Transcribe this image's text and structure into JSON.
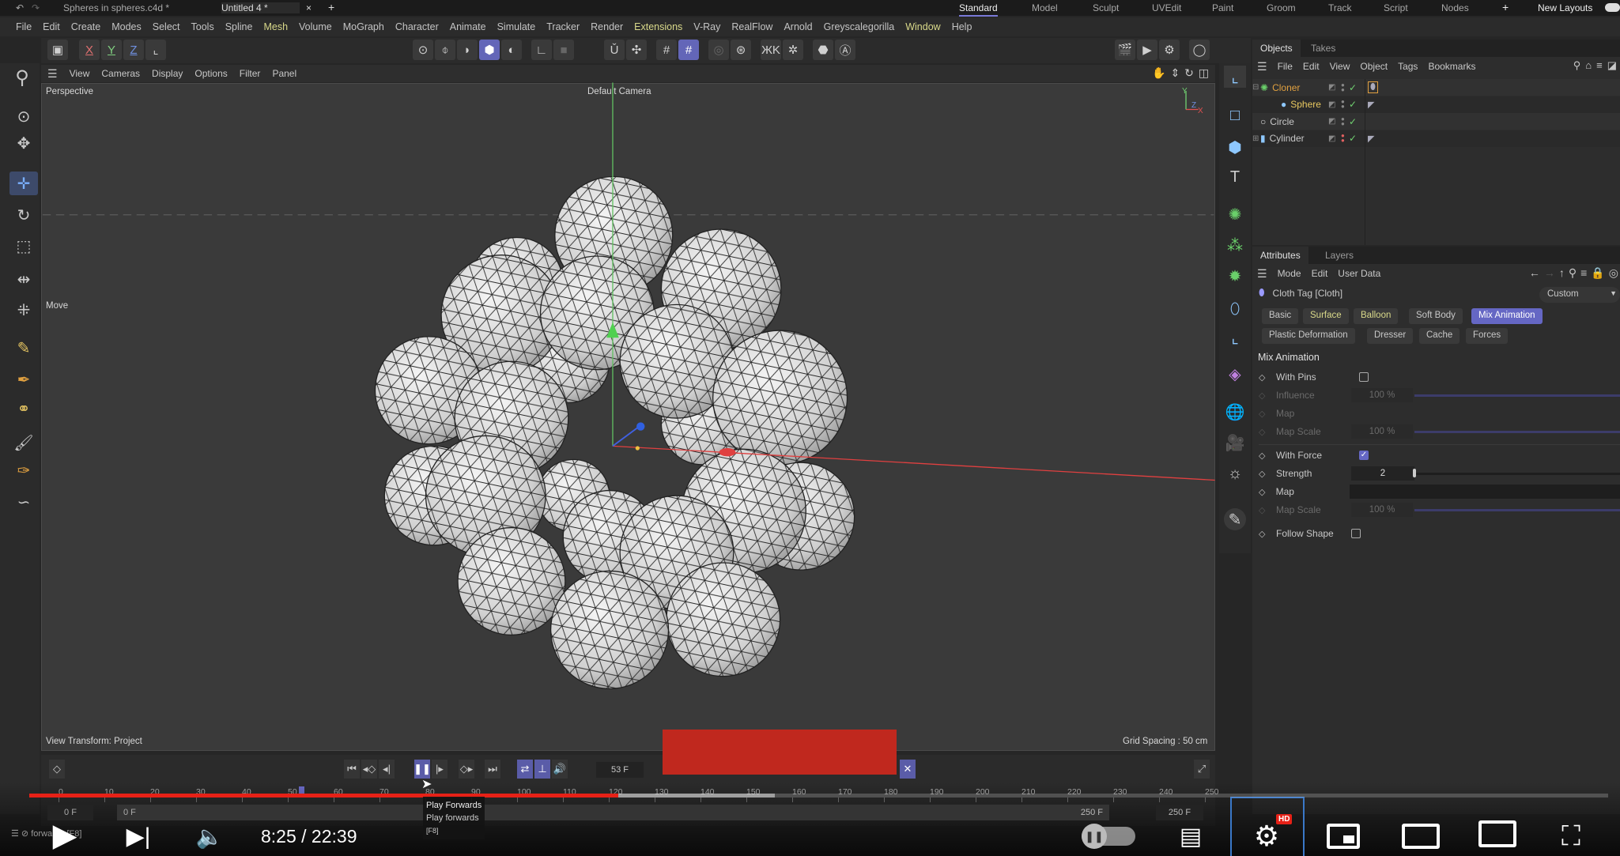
{
  "title_tabs": {
    "undo_icon": "undo-icon",
    "redo_icon": "redo-icon",
    "tabs": [
      {
        "label": "Spheres in spheres.c4d *"
      },
      {
        "label": "Untitled 4 *"
      }
    ],
    "close": "×",
    "add": "+"
  },
  "layouts": {
    "items": [
      "Standard",
      "Model",
      "Sculpt",
      "UVEdit",
      "Paint",
      "Groom",
      "Track",
      "Script",
      "Nodes"
    ],
    "active": "Standard",
    "add": "+",
    "new_layouts": "New Layouts"
  },
  "menu": [
    "File",
    "Edit",
    "Create",
    "Modes",
    "Select",
    "Tools",
    "Spline",
    "Mesh",
    "Volume",
    "MoGraph",
    "Character",
    "Animate",
    "Simulate",
    "Tracker",
    "Render",
    "Extensions",
    "V-Ray",
    "RealFlow",
    "Arnold",
    "Greyscalegorilla",
    "Window",
    "Help"
  ],
  "menu_highlighted": [
    "Mesh",
    "Extensions",
    "Window"
  ],
  "toolbar": {
    "x": "X",
    "y": "Y",
    "z": "Z"
  },
  "viewport": {
    "menu": [
      "View",
      "Cameras",
      "Display",
      "Options",
      "Filter",
      "Panel"
    ],
    "projection": "Perspective",
    "camera": "Default Camera",
    "tool": "Move",
    "view_transform": "View Transform: Project",
    "grid_spacing": "Grid Spacing : 50 cm",
    "axis_y": "Y",
    "axis_z": "Z",
    "axis_x": "X"
  },
  "objects_panel": {
    "tabs": [
      "Objects",
      "Takes"
    ],
    "menu": [
      "File",
      "Edit",
      "View",
      "Object",
      "Tags",
      "Bookmarks"
    ],
    "rows": [
      {
        "name": "Cloner",
        "color": "#e0a040",
        "expand": "⊟"
      },
      {
        "name": "Sphere",
        "color": "#e8c860",
        "expand": ""
      },
      {
        "name": "Circle",
        "color": "#c8c8c8",
        "expand": ""
      },
      {
        "name": "Cylinder",
        "color": "#c8c8c8",
        "expand": "⊞"
      }
    ]
  },
  "attributes_panel": {
    "tabs": [
      "Attributes",
      "Layers"
    ],
    "menu": [
      "Mode",
      "Edit",
      "User Data"
    ],
    "object": "Cloth Tag [Cloth]",
    "preset": "Custom",
    "tab_buttons": [
      "Basic",
      "Surface",
      "Balloon",
      "Soft Body",
      "Mix Animation",
      "Plastic Deformation",
      "Dresser",
      "Cache",
      "Forces"
    ],
    "active_tab": "Mix Animation",
    "section": "Mix Animation",
    "params": {
      "with_pins": {
        "label": "With Pins",
        "checked": false
      },
      "influence": {
        "label": "Influence",
        "value": "100 %"
      },
      "map1": {
        "label": "Map"
      },
      "map_scale1": {
        "label": "Map Scale",
        "value": "100 %"
      },
      "with_force": {
        "label": "With Force",
        "checked": true
      },
      "strength": {
        "label": "Strength",
        "value": "2"
      },
      "map2": {
        "label": "Map"
      },
      "map_scale2": {
        "label": "Map Scale",
        "value": "100 %"
      },
      "follow_shape": {
        "label": "Follow Shape",
        "checked": false
      }
    }
  },
  "timeline": {
    "current_frame": "53 F",
    "current_frame_value": 53,
    "ticks": [
      "0",
      "10",
      "20",
      "30",
      "40",
      "50",
      "60",
      "70",
      "80",
      "90",
      "100",
      "110",
      "120",
      "130",
      "140",
      "150",
      "160",
      "170",
      "180",
      "190",
      "200",
      "210",
      "220",
      "230",
      "240",
      "250"
    ],
    "start": "0 F",
    "range_start": "0 F",
    "range_end": "250 F",
    "end": "250 F"
  },
  "tooltip": {
    "title": "Play Forwards",
    "desc": "Play forwards",
    "key": "[F8]"
  },
  "status_text": "forwards [F8]",
  "video_player": {
    "time": "8:25 / 22:39",
    "progress_percent": 37.3,
    "buffered_percent": 47.2,
    "hd_badge": "HD",
    "progress_color": "#e62117",
    "redaction_color": "#c0281e"
  }
}
